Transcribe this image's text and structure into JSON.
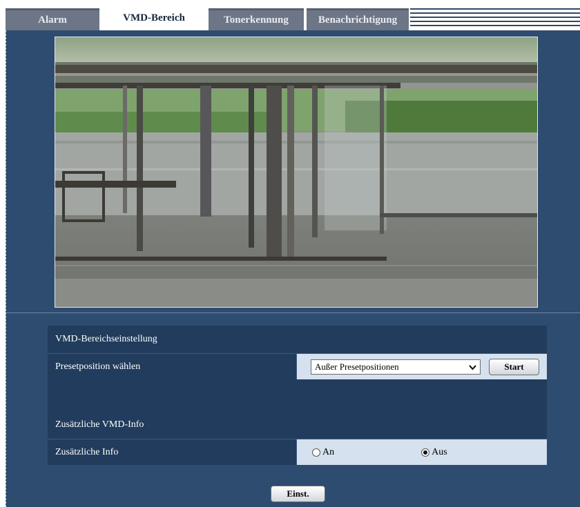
{
  "tabs": [
    {
      "label": "Alarm",
      "active": false
    },
    {
      "label": "VMD-Bereich",
      "active": true
    },
    {
      "label": "Tonerkennung",
      "active": false
    },
    {
      "label": "Benachrichtigung",
      "active": false
    }
  ],
  "camera": {
    "icon": "camera-preview-image"
  },
  "vmd_area": {
    "section_title": "VMD-Bereichseinstellung",
    "preset_label": "Presetposition wählen",
    "preset_selected": "Außer Presetpositionen",
    "start_label": "Start"
  },
  "extra_info": {
    "section_title": "Zusätzliche VMD-Info",
    "info_label": "Zusätzliche Info",
    "options": [
      {
        "label": "An",
        "checked": false
      },
      {
        "label": "Aus",
        "checked": true
      }
    ]
  },
  "footer": {
    "set_label": "Einst."
  },
  "colors": {
    "panel": "#2e4c70",
    "row_dark": "#213c5c",
    "row_value": "#d5e1ef",
    "tab_inactive": "#6d7686"
  }
}
